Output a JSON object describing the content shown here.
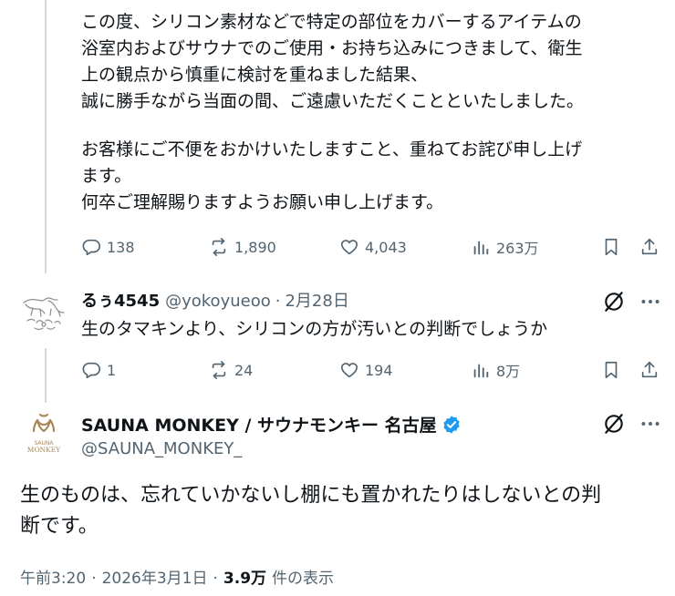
{
  "original_post": {
    "paragraph1": [
      "この度、シリコン素材などで特定の部位をカバーするアイテムの",
      "浴室内およびサウナでのご使用・お持ち込みにつきまして、衛生",
      "上の観点から慎重に検討を重ねました結果、",
      "誠に勝手ながら当面の間、ご遠慮いただくことといたしました。"
    ],
    "paragraph2": [
      "お客様にご不便をおかけいたしますこと、重ねてお詫び申し上げ",
      "ます。",
      "何卒ご理解賜りますようお願い申し上げます。"
    ],
    "metrics": {
      "replies": "138",
      "reposts": "1,890",
      "likes": "4,043",
      "views": "263万"
    }
  },
  "reply": {
    "display_name": "るぅ4545",
    "handle": "@yokoyueoo",
    "separator": "·",
    "date": "2月28日",
    "text": "生のタマキンより、シリコンの方が汚いとの判断でしょうか",
    "metrics": {
      "replies": "1",
      "reposts": "24",
      "likes": "194",
      "views": "8万"
    }
  },
  "main_post": {
    "display_name": "SAUNA MONKEY / サウナモンキー 名古屋",
    "handle": "@SAUNA_MONKEY_",
    "avatar_text": {
      "line1": "SAUNA",
      "line2": "MONKEY"
    },
    "text": [
      "生のものは、忘れていかないし棚にも置かれたりはしないとの判",
      "断です。"
    ],
    "meta": {
      "time": "午前3:20",
      "sep1": "·",
      "date": "2026年3月1日",
      "sep2": "·",
      "views_count": "3.9万",
      "views_label": "件の表示"
    }
  },
  "colors": {
    "text": "#0f1419",
    "muted": "#536471",
    "verified": "#1d9bf0",
    "brand_gold": "#a8895c",
    "line": "#cfd9de"
  },
  "icons": [
    "reply-icon",
    "repost-icon",
    "like-icon",
    "views-icon",
    "bookmark-icon",
    "share-icon",
    "grok-icon",
    "more-icon",
    "verified-badge-icon"
  ]
}
